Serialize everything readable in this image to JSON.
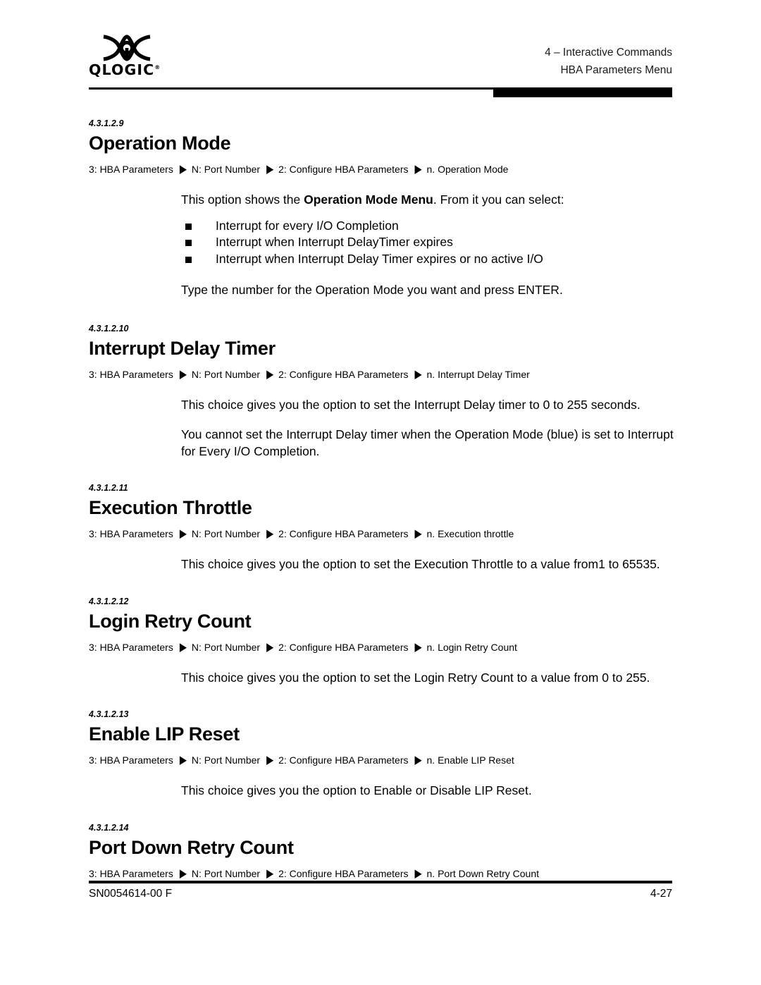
{
  "header": {
    "logo_alt": "QLOGIC",
    "logo_wordmark": "QLOGIC",
    "logo_registered": "®",
    "chapter": "4 – Interactive Commands",
    "menu": "HBA Parameters Menu"
  },
  "footer": {
    "doc_number": "SN0054614-00  F",
    "page_number": "4-27"
  },
  "breadcrumb_common": {
    "root": "3: HBA Parameters",
    "port": "N: Port Number",
    "configure": "2: Configure HBA Parameters",
    "arrow": "▶"
  },
  "sections": [
    {
      "number": "4.3.1.2.9",
      "title": "Operation Mode",
      "breadcrumb_leaf": "n. Operation Mode",
      "intro_before": "This option shows the ",
      "intro_bold": "Operation Mode Menu",
      "intro_after": ". From it you can select:",
      "bullets": [
        "Interrupt for every I/O Completion",
        "Interrupt when Interrupt DelayTimer expires",
        "Interrupt when Interrupt Delay Timer expires or no active I/O"
      ],
      "closing": "Type the number for the Operation Mode you want and press ENTER."
    },
    {
      "number": "4.3.1.2.10",
      "title": "Interrupt Delay Timer",
      "breadcrumb_leaf": "n. Interrupt Delay Timer",
      "para1": "This choice gives you the option to set the Interrupt Delay timer to 0 to 255 seconds.",
      "para2": "You cannot set the Interrupt Delay timer when the Operation Mode (blue) is set to Interrupt for Every I/O Completion."
    },
    {
      "number": "4.3.1.2.11",
      "title": "Execution Throttle",
      "breadcrumb_leaf": "n. Execution throttle",
      "para1": "This choice gives you the option to set the Execution Throttle to a value from1 to 65535."
    },
    {
      "number": "4.3.1.2.12",
      "title": "Login Retry Count",
      "breadcrumb_leaf": "n. Login Retry Count",
      "para1": "This choice gives you the option to set the Login Retry Count to a value from 0 to 255."
    },
    {
      "number": "4.3.1.2.13",
      "title": "Enable LIP Reset",
      "breadcrumb_leaf": "n. Enable LIP Reset",
      "para1": "This choice gives you the option to Enable or Disable LIP Reset."
    },
    {
      "number": "4.3.1.2.14",
      "title": "Port Down Retry Count",
      "breadcrumb_leaf": "n. Port Down Retry Count"
    }
  ],
  "colors": {
    "text": "#000000",
    "background": "#ffffff",
    "rule": "#000000"
  }
}
